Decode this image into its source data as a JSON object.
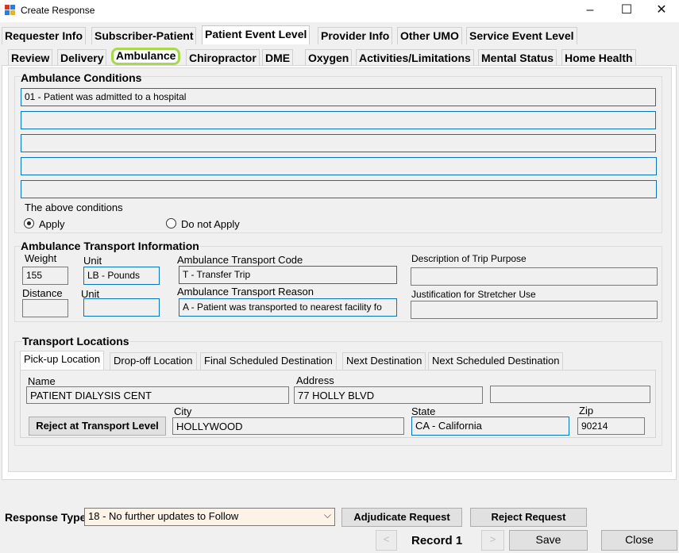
{
  "window": {
    "title": "Create Response",
    "minimize": "–",
    "maximize": "☐",
    "close": "✕"
  },
  "tabs_main": [
    "Requester Info",
    "Subscriber-Patient",
    "Patient Event Level",
    "Provider Info",
    "Other UMO",
    "Service Event Level"
  ],
  "tabs_sub": [
    "Review",
    "Delivery",
    "Ambulance",
    "Chiropractor",
    "DME",
    "Oxygen",
    "Activities/Limitations",
    "Mental Status",
    "Home Health"
  ],
  "conditions": {
    "title": "Ambulance Conditions",
    "values": [
      "01 - Patient was admitted to a hospital",
      "",
      "",
      "",
      ""
    ],
    "above_label": "The above conditions",
    "apply_label": "Apply",
    "apply_selected": true,
    "do_not_apply_label": "Do not Apply"
  },
  "transport_info": {
    "title": "Ambulance Transport Information",
    "weight_label": "Weight",
    "weight_value": "155",
    "unit_label": "Unit",
    "unit_value": "LB - Pounds",
    "code_label": "Ambulance Transport Code",
    "code_value": "T - Transfer Trip",
    "purpose_label": "Description of Trip Purpose",
    "purpose_value": "",
    "distance_label": "Distance",
    "distance_value": "",
    "unit2_label": "Unit",
    "unit2_value": "",
    "reason_label": "Ambulance Transport Reason",
    "reason_value": "A - Patient was transported to nearest facility fo",
    "stretcher_label": "Justification for Stretcher Use",
    "stretcher_value": ""
  },
  "locations": {
    "title": "Transport Locations",
    "tabs": [
      "Pick-up Location",
      "Drop-off Location",
      "Final Scheduled Destination",
      "Next Destination",
      "Next Scheduled Destination"
    ],
    "name_label": "Name",
    "name_value": "PATIENT DIALYSIS CENT",
    "address_label": "Address",
    "address_value": "77 HOLLY BLVD",
    "address2_value": "",
    "reject_label": "Reject at Transport Level",
    "city_label": "City",
    "city_value": "HOLLYWOOD",
    "state_label": "State",
    "state_value": "CA - California",
    "zip_label": "Zip",
    "zip_value": "90214"
  },
  "footer": {
    "response_type_label": "Response Type",
    "response_type_value": "18 - No further updates to Follow",
    "adjudicate_label": "Adjudicate Request",
    "reject_label": "Reject Request",
    "prev_label": "<",
    "record_label": "Record 1",
    "next_label": ">",
    "save_label": "Save",
    "close_label": "Close"
  },
  "colors": {
    "highlight_ring": "#a6d94b",
    "focus_border": "#0a74b9",
    "dropdown_bg": "#fdf2e6"
  }
}
